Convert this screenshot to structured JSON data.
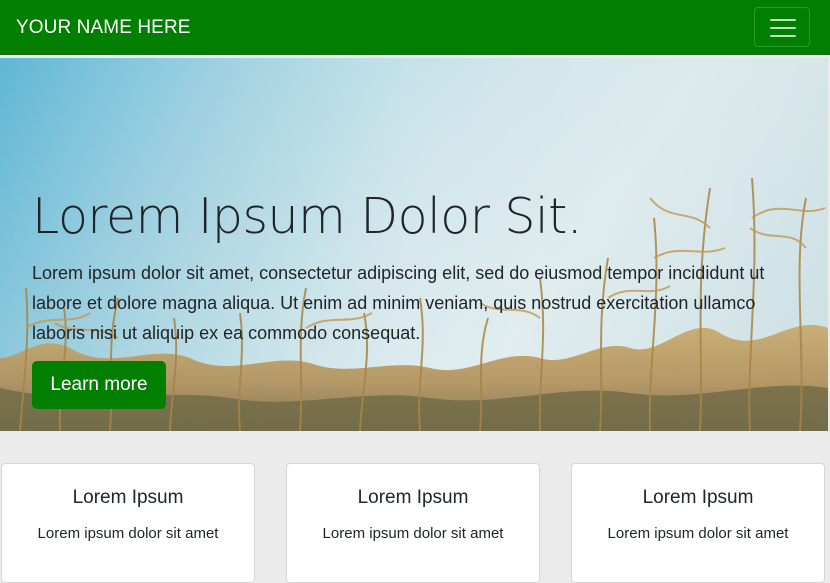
{
  "navbar": {
    "brand": "YOUR NAME HERE",
    "toggler_icon": "hamburger-menu-icon",
    "background_color": "#007f00"
  },
  "hero": {
    "title": "Lorem Ipsum Dolor Sit.",
    "text": "Lorem ipsum dolor sit amet, consectetur adipiscing elit, sed do eiusmod tempor incididunt ut labore et dolore magna aliqua. Ut enim ad minim veniam, quis nostrud exercitation ullamco laboris nisi ut aliquip ex ea commodo consequat.",
    "button_label": "Learn more",
    "button_color": "#007f00",
    "background_image": "cornfield-against-blue-sky"
  },
  "cards": [
    {
      "title": "Lorem Ipsum",
      "text": "Lorem ipsum dolor sit amet"
    },
    {
      "title": "Lorem Ipsum",
      "text": "Lorem ipsum dolor sit amet"
    },
    {
      "title": "Lorem Ipsum",
      "text": "Lorem ipsum dolor sit amet"
    }
  ]
}
